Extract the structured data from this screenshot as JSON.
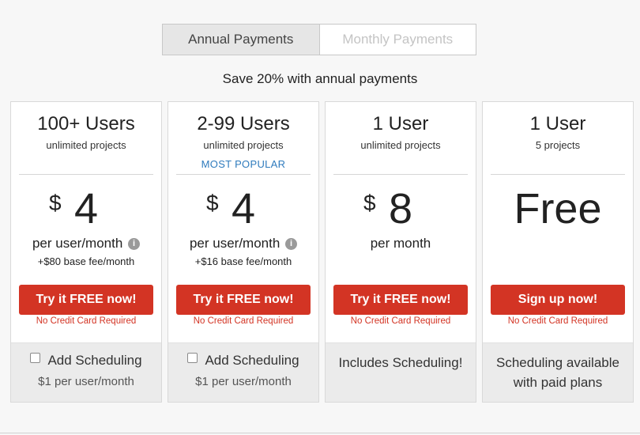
{
  "billing_toggle": {
    "annual_label": "Annual Payments",
    "monthly_label": "Monthly Payments"
  },
  "save_message": "Save 20% with annual payments",
  "colors": {
    "cta": "#d33424",
    "popular": "#2f7bbd",
    "active_tab": "#e6e6e6"
  },
  "plans": [
    {
      "users": "100+ Users",
      "projects": "unlimited projects",
      "currency": "$",
      "amount": "4",
      "per": "per user/month",
      "fee": "+$80 base fee/month",
      "cta": "Try it FREE now!",
      "no_cc": "No Credit Card Required",
      "scheduling_label": "Add Scheduling",
      "scheduling_price": "$1 per user/month"
    },
    {
      "users": "2-99 Users",
      "projects": "unlimited projects",
      "badge": "MOST POPULAR",
      "currency": "$",
      "amount": "4",
      "per": "per user/month",
      "fee": "+$16 base fee/month",
      "cta": "Try it FREE now!",
      "no_cc": "No Credit Card Required",
      "scheduling_label": "Add Scheduling",
      "scheduling_price": "$1 per user/month"
    },
    {
      "users": "1 User",
      "projects": "unlimited projects",
      "currency": "$",
      "amount": "8",
      "per": "per month",
      "cta": "Try it FREE now!",
      "no_cc": "No Credit Card Required",
      "scheduling_note": "Includes Scheduling!"
    },
    {
      "users": "1 User",
      "projects": "5 projects",
      "amount": "Free",
      "cta": "Sign up now!",
      "no_cc": "No Credit Card Required",
      "scheduling_note_line1": "Scheduling available",
      "scheduling_note_line2": "with paid plans"
    }
  ],
  "info_icon_glyph": "i"
}
